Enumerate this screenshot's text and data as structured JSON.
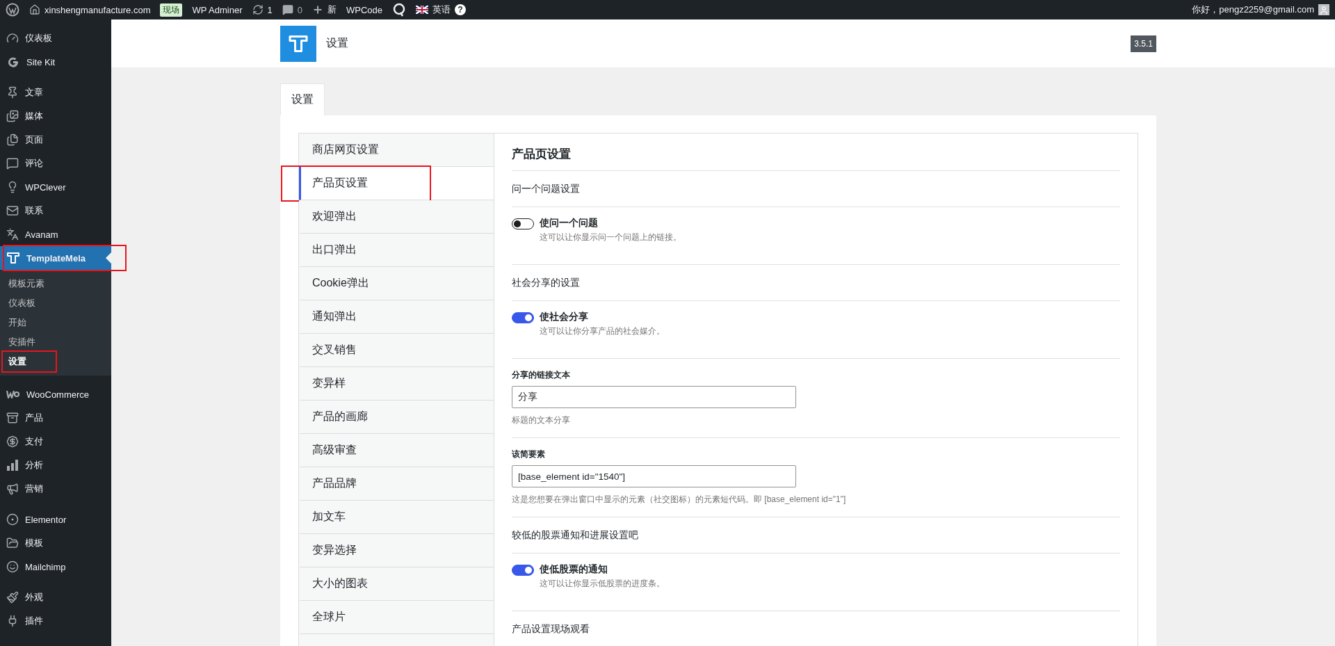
{
  "admin_bar": {
    "site": "xinshengmanufacture.com",
    "badge": "现场",
    "adminer": "WP Adminer",
    "updates": "1",
    "comments": "0",
    "new": "新",
    "wpcode": "WPCode",
    "language": "英语",
    "help": "?",
    "greeting": "你好，pengz2259@gmail.com"
  },
  "sidebar": {
    "groups": [
      [
        {
          "label": "仪表板",
          "selected": false,
          "annotated": false
        },
        {
          "label": "Site Kit",
          "selected": false,
          "annotated": false
        }
      ],
      [
        {
          "label": "文章",
          "selected": false,
          "annotated": false
        },
        {
          "label": "媒体",
          "selected": false,
          "annotated": false
        },
        {
          "label": "页面",
          "selected": false,
          "annotated": false
        },
        {
          "label": "评论",
          "selected": false,
          "annotated": false
        },
        {
          "label": "WPClever",
          "selected": false,
          "annotated": false
        },
        {
          "label": "联系",
          "selected": false,
          "annotated": false
        },
        {
          "label": "Avanam",
          "selected": false,
          "annotated": false
        },
        {
          "label": "TemplateMela",
          "selected": true,
          "annotated": true,
          "children": [
            {
              "label": "模板元素",
              "selected": false,
              "annotated": false
            },
            {
              "label": "仪表板",
              "selected": false,
              "annotated": false
            },
            {
              "label": "开始",
              "selected": false,
              "annotated": false
            },
            {
              "label": "安插件",
              "selected": false,
              "annotated": false
            },
            {
              "label": "设置",
              "selected": true,
              "annotated": true
            }
          ]
        }
      ],
      [
        {
          "label": "WooCommerce",
          "selected": false,
          "annotated": false
        },
        {
          "label": "产品",
          "selected": false,
          "annotated": false
        },
        {
          "label": "支付",
          "selected": false,
          "annotated": false
        },
        {
          "label": "分析",
          "selected": false,
          "annotated": false
        },
        {
          "label": "营销",
          "selected": false,
          "annotated": false
        }
      ],
      [
        {
          "label": "Elementor",
          "selected": false,
          "annotated": false
        },
        {
          "label": "模板",
          "selected": false,
          "annotated": false
        },
        {
          "label": "Mailchimp",
          "selected": false,
          "annotated": false
        }
      ],
      [
        {
          "label": "外观",
          "selected": false,
          "annotated": false
        },
        {
          "label": "插件",
          "selected": false,
          "annotated": false
        }
      ]
    ]
  },
  "header": {
    "title": "设置",
    "version": "3.5.1"
  },
  "tabs": [
    {
      "label": "设置",
      "selected": true
    }
  ],
  "settings_nav": [
    {
      "label": "商店网页设置",
      "selected": false,
      "annotated": false
    },
    {
      "label": "产品页设置",
      "selected": true,
      "annotated": true
    },
    {
      "label": "欢迎弹出",
      "selected": false,
      "annotated": false
    },
    {
      "label": "出口弹出",
      "selected": false,
      "annotated": false
    },
    {
      "label": "Cookie弹出",
      "selected": false,
      "annotated": false
    },
    {
      "label": "通知弹出",
      "selected": false,
      "annotated": false
    },
    {
      "label": "交叉销售",
      "selected": false,
      "annotated": false
    },
    {
      "label": "变异样",
      "selected": false,
      "annotated": false
    },
    {
      "label": "产品的画廊",
      "selected": false,
      "annotated": false
    },
    {
      "label": "高级审查",
      "selected": false,
      "annotated": false
    },
    {
      "label": "产品品牌",
      "selected": false,
      "annotated": false
    },
    {
      "label": "加文车",
      "selected": false,
      "annotated": false
    },
    {
      "label": "变异选择",
      "selected": false,
      "annotated": false
    },
    {
      "label": "大小的图表",
      "selected": false,
      "annotated": false
    },
    {
      "label": "全球片",
      "selected": false,
      "annotated": false
    }
  ],
  "panel": {
    "title": "产品页设置",
    "rows": [
      {
        "kind": "section",
        "label": "问一个问题设置"
      },
      {
        "kind": "toggle",
        "label": "使问一个问题",
        "description": "这可以让你显示问一个问题上的链接。",
        "on": false
      },
      {
        "kind": "section",
        "label": "社会分享的设置"
      },
      {
        "kind": "toggle",
        "label": "使社会分享",
        "description": "这可以让你分享产品的社会媒介。",
        "on": true
      },
      {
        "kind": "field",
        "label": "分享的链接文本",
        "value": "分享",
        "help": "标题的文本分享"
      },
      {
        "kind": "field",
        "label": "该简要素",
        "value": "[base_element id=\"1540\"]",
        "help": "这是您想要在弹出窗口中显示的元素（社交图标）的元素短代码。即 [base_element id=\"1\"]"
      },
      {
        "kind": "section",
        "label": "较低的股票通知和进展设置吧"
      },
      {
        "kind": "toggle",
        "label": "使低股票的通知",
        "description": "这可以让你显示低股票的进度条。",
        "on": true
      },
      {
        "kind": "section",
        "label": "产品设置现场观看"
      }
    ]
  }
}
